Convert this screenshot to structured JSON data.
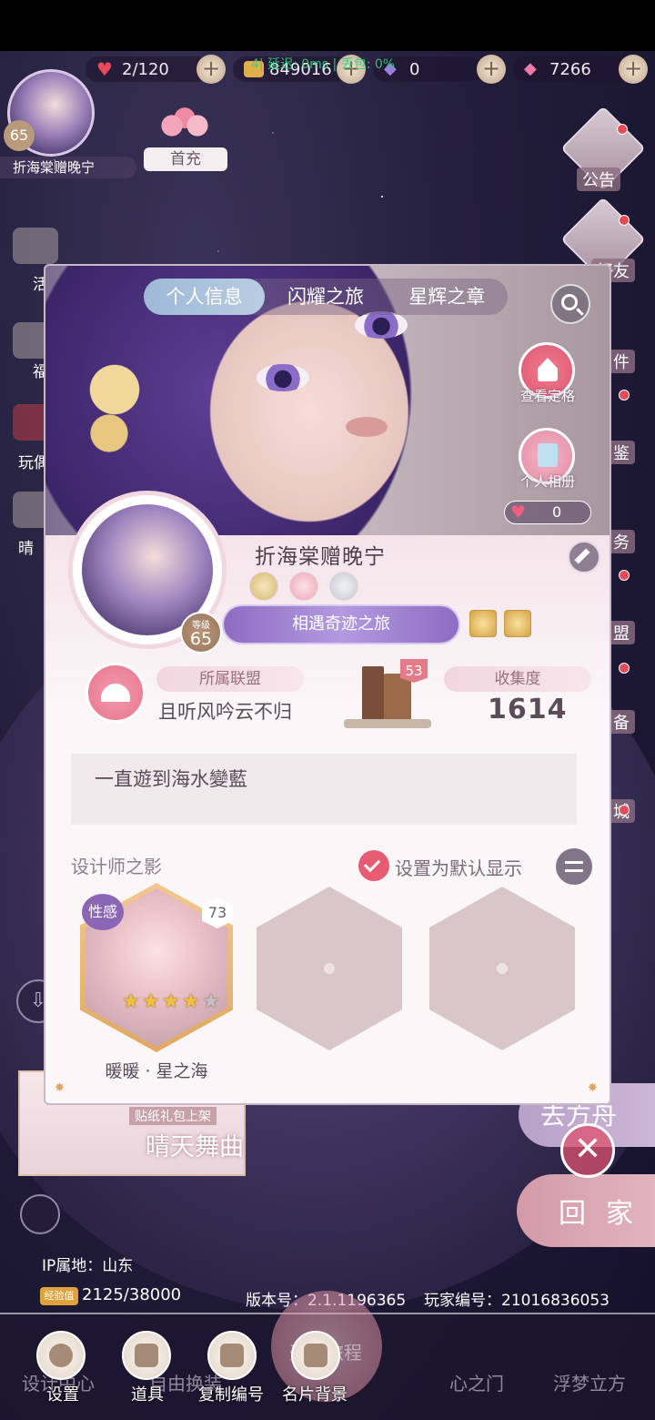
{
  "resources": {
    "stamina": "2/120",
    "gold": "849016",
    "diamonds_purple": "0",
    "diamonds_pink": "7266",
    "net_overlay": "4| 延迟: 0ms | 丢包: 0%"
  },
  "player_corner": {
    "level": "65",
    "name": "折海棠赠晚宁",
    "recharge_label": "首充"
  },
  "left_sidebar": {
    "items": [
      "活",
      "福",
      "玩偶",
      "晴"
    ]
  },
  "right_sidebar": {
    "items": [
      "公告",
      "好友",
      "件",
      "鉴",
      "务",
      "盟",
      "备",
      "城"
    ]
  },
  "banner": {
    "sub_label": "贴纸礼包上架",
    "title": "晴天舞曲"
  },
  "side_actions": {
    "boat": "去方舟",
    "home": "回家"
  },
  "panel": {
    "tabs": [
      {
        "label": "个人信息",
        "active": true
      },
      {
        "label": "闪耀之旅",
        "active": false
      },
      {
        "label": "星辉之章",
        "active": false
      }
    ],
    "view_pose_label": "查看定格",
    "album_label": "个人相册",
    "likes": "0",
    "player_name": "折海棠赠晚宁",
    "level_caption": "等级",
    "level": "65",
    "journey_label": "相遇奇迹之旅",
    "alliance_label": "所属联盟",
    "alliance_name": "且听风吟云不归",
    "collection_badge": "53",
    "collection_label": "收集度",
    "collection_value": "1614",
    "signature": "一直遊到海水變藍",
    "designer_header": "设计师之影",
    "default_display_label": "设置为默认显示",
    "designer_card": {
      "tag": "性感",
      "level": "73",
      "stars": 4,
      "name": "暖暖 · 星之海"
    }
  },
  "footer": {
    "ip_location": "IP属地：山东",
    "exp_badge": "经验值",
    "exp_value": "2125/38000",
    "version": "版本号：2.1.1196365",
    "player_id": "玩家编号：21016836053"
  },
  "bottom_bg_nav": [
    "设计中心",
    "自由换装",
    "开始旅程",
    "心之门",
    "浮梦立方"
  ],
  "bottom_actions": [
    {
      "label": "设置",
      "icon": "gear-icon"
    },
    {
      "label": "道具",
      "icon": "chest-icon"
    },
    {
      "label": "复制编号",
      "icon": "copy-icon"
    },
    {
      "label": "名片背景",
      "icon": "card-icon"
    }
  ],
  "colors": {
    "accent_pink": "#e75b73",
    "journey_purple": "#8d6cc2",
    "tab_active_blue": "#9eb8d6"
  }
}
